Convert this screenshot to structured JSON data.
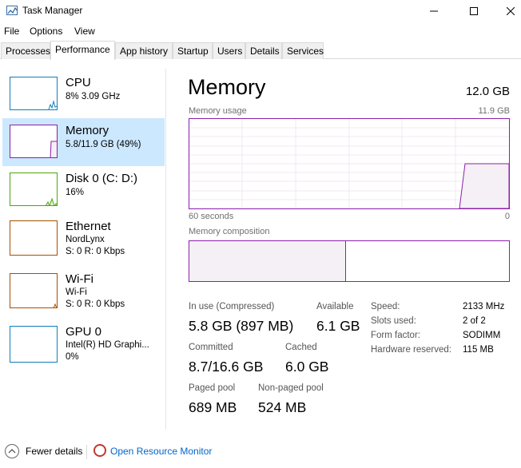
{
  "window": {
    "title": "Task Manager"
  },
  "menu": [
    "File",
    "Options",
    "View"
  ],
  "tabs": [
    "Processes",
    "Performance",
    "App history",
    "Startup",
    "Users",
    "Details",
    "Services"
  ],
  "active_tab": "Performance",
  "sidebar": [
    {
      "name": "CPU",
      "line1": "8%  3.09 GHz",
      "line2": "",
      "color": "#117dbb"
    },
    {
      "name": "Memory",
      "line1": "5.8/11.9 GB (49%)",
      "line2": "",
      "color": "#8b1fa9"
    },
    {
      "name": "Disk 0 (C: D:)",
      "line1": "16%",
      "line2": "",
      "color": "#4da60c"
    },
    {
      "name": "Ethernet",
      "line1": "NordLynx",
      "line2": "S: 0  R: 0 Kbps",
      "color": "#a74f01"
    },
    {
      "name": "Wi-Fi",
      "line1": "Wi-Fi",
      "line2": "S: 0  R: 0 Kbps",
      "color": "#a74f01"
    },
    {
      "name": "GPU 0",
      "line1": "Intel(R) HD Graphi...",
      "line2": "0%",
      "color": "#117dbb"
    }
  ],
  "main": {
    "title": "Memory",
    "total": "12.0 GB",
    "usage_label": "Memory usage",
    "usage_max": "11.9 GB",
    "time_label": "60 seconds",
    "time_end": "0",
    "composition_label": "Memory composition",
    "composition_in_use_fraction": 0.49
  },
  "stats": {
    "in_use_label": "In use (Compressed)",
    "in_use_value": "5.8 GB (897 MB)",
    "available_label": "Available",
    "available_value": "6.1 GB",
    "committed_label": "Committed",
    "committed_value": "8.7/16.6 GB",
    "cached_label": "Cached",
    "cached_value": "6.0 GB",
    "paged_label": "Paged pool",
    "paged_value": "689 MB",
    "nonpaged_label": "Non-paged pool",
    "nonpaged_value": "524 MB"
  },
  "specs": {
    "speed_label": "Speed:",
    "speed_value": "2133 MHz",
    "slots_label": "Slots used:",
    "slots_value": "2 of 2",
    "form_label": "Form factor:",
    "form_value": "SODIMM",
    "reserved_label": "Hardware reserved:",
    "reserved_value": "115 MB"
  },
  "footer": {
    "fewer": "Fewer details",
    "monitor": "Open Resource Monitor"
  }
}
